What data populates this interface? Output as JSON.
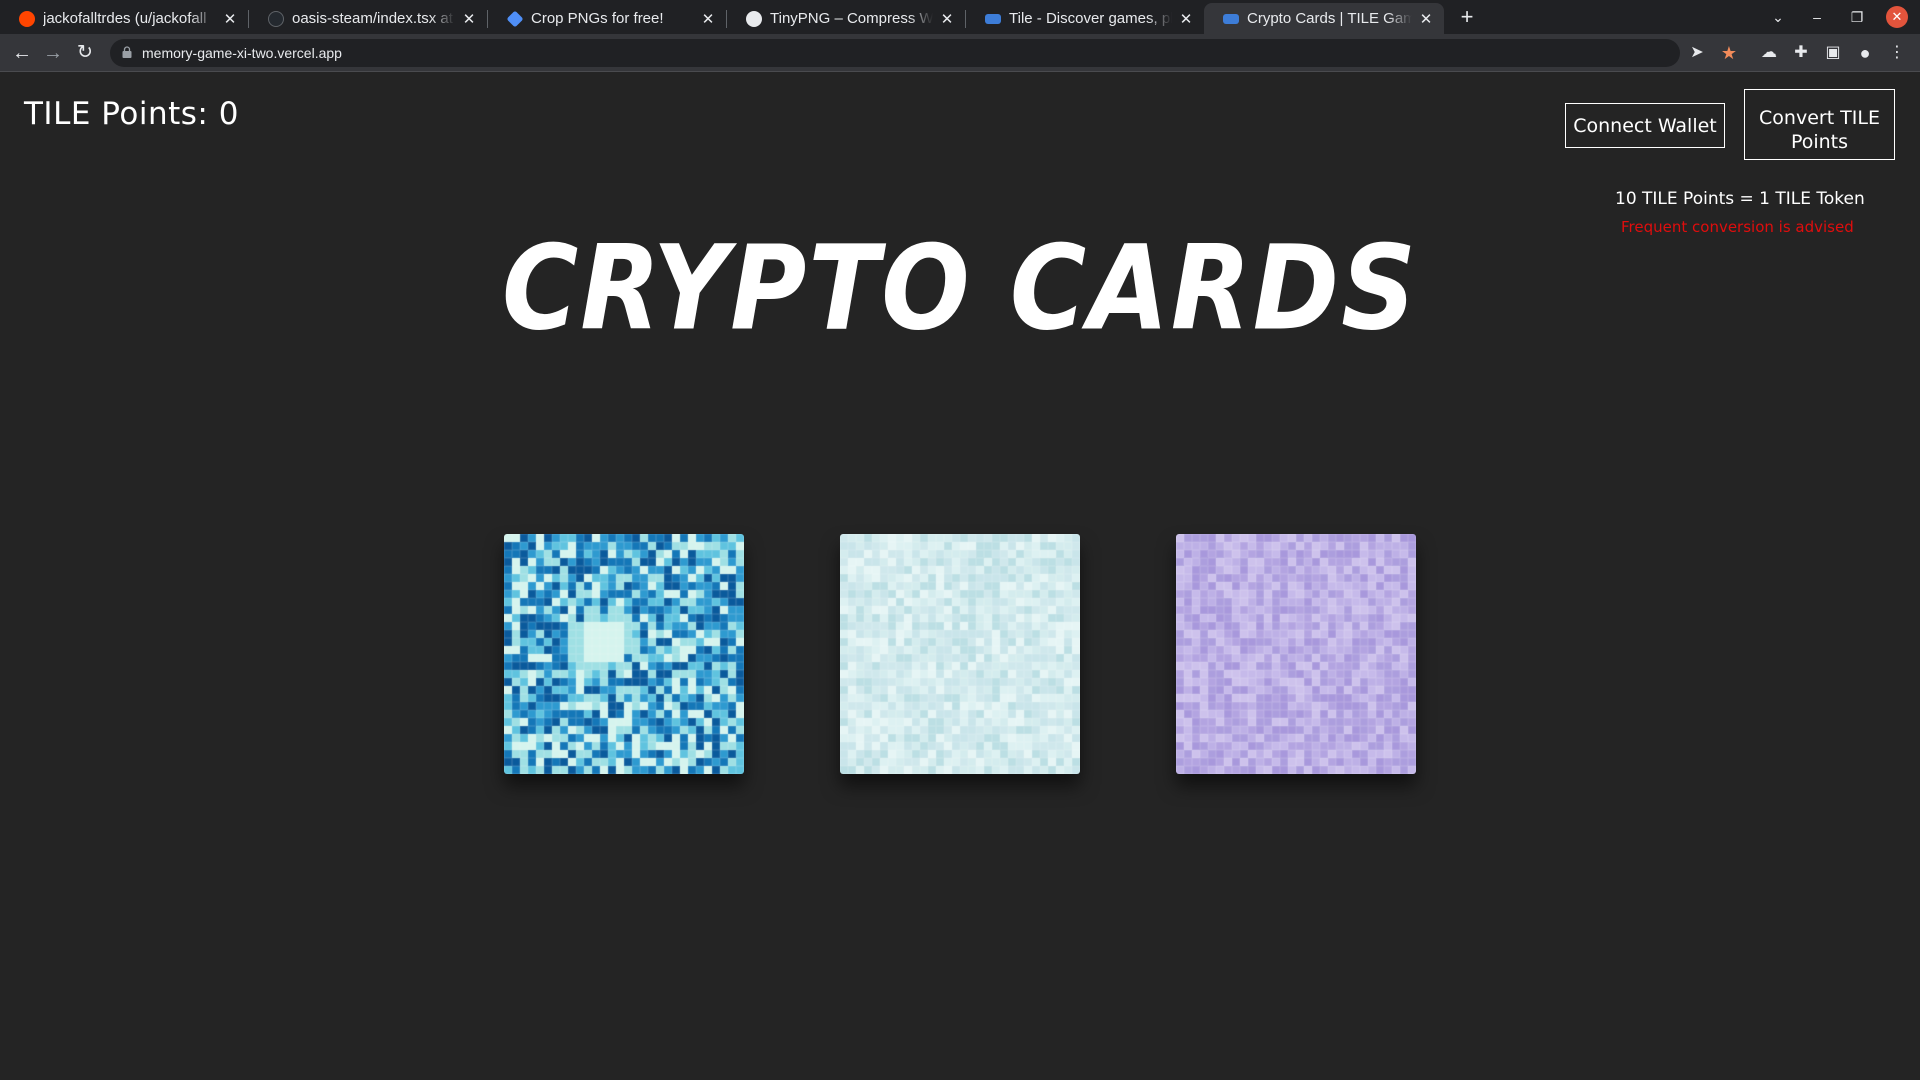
{
  "browser": {
    "tabs": [
      {
        "title": "jackofalltrdes (u/jackofall",
        "favicon": "reddit-icon",
        "color": "#ff4500",
        "active": false
      },
      {
        "title": "oasis-steam/index.tsx at",
        "favicon": "github-icon",
        "color": "#24292f",
        "active": false
      },
      {
        "title": "Crop PNGs for free!",
        "favicon": "diamond-icon",
        "color": "#4f8ff7",
        "active": false
      },
      {
        "title": "TinyPNG – Compress Web",
        "favicon": "panda-icon",
        "color": "#e8eaed",
        "active": false
      },
      {
        "title": "Tile - Discover games, play",
        "favicon": "tile-icon",
        "color": "#3d7dd8",
        "active": false
      },
      {
        "title": "Crypto Cards | TILE Games",
        "favicon": "tile-icon",
        "color": "#3d7dd8",
        "active": true
      }
    ],
    "url": "memory-game-xi-two.vercel.app"
  },
  "page": {
    "points_label": "TILE Points: 0",
    "connect_wallet": "Connect Wallet",
    "convert_points": "Convert TILE Points",
    "rate": "10 TILE Points = 1 TILE Token",
    "advice": "Frequent conversion is advised",
    "title": "CRYPTO CARDS",
    "cards": [
      {
        "name": "blue-mosaic-card",
        "palette": [
          "#0a5a9c",
          "#1477b8",
          "#2e9ad0",
          "#5fc3df",
          "#9fe0e4",
          "#d5f4ee"
        ]
      },
      {
        "name": "pale-mosaic-card",
        "palette": [
          "#bcdfe4",
          "#c9e5ea",
          "#d4ecee",
          "#ddf1f2",
          "#e6f5f5",
          "#cfe8ec"
        ]
      },
      {
        "name": "lavender-mosaic-card",
        "palette": [
          "#a898dc",
          "#b3a4e1",
          "#bdb0e6",
          "#c6baea",
          "#ac9ede",
          "#cdc2ec"
        ]
      }
    ]
  }
}
